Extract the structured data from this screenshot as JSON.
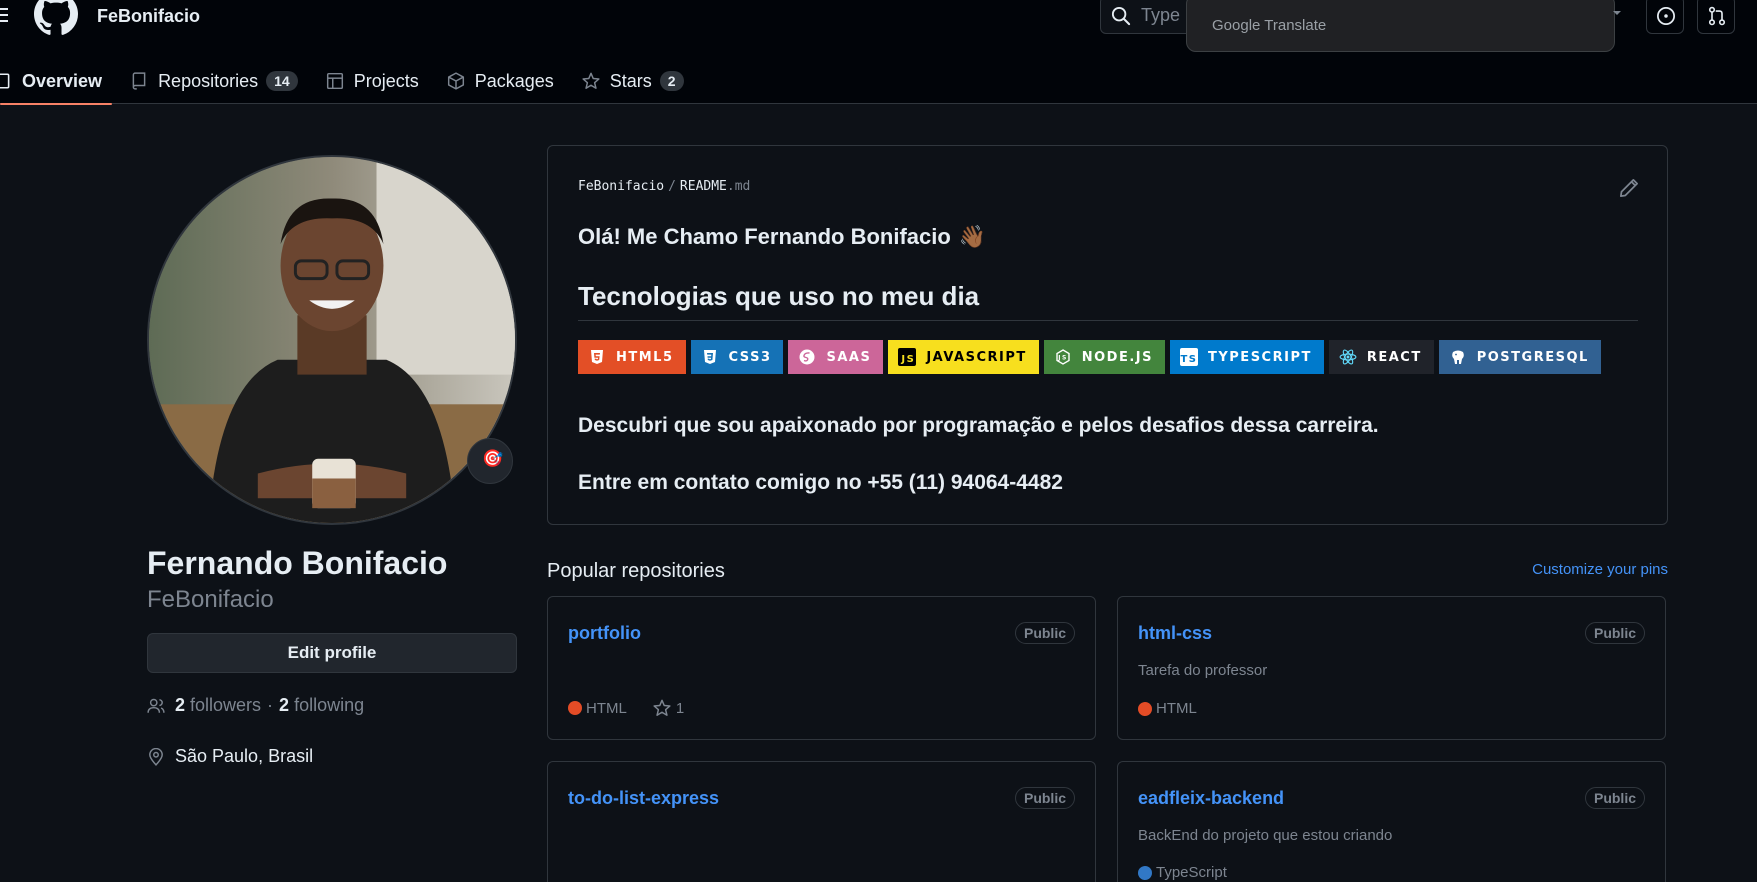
{
  "header": {
    "username": "FeBonifacio",
    "search_placeholder": "Type [",
    "translate_label": "Google Translate"
  },
  "tabs": [
    {
      "label": "Overview",
      "active": true
    },
    {
      "label": "Repositories",
      "count": "14"
    },
    {
      "label": "Projects"
    },
    {
      "label": "Packages"
    },
    {
      "label": "Stars",
      "count": "2"
    }
  ],
  "profile": {
    "full_name": "Fernando Bonifacio",
    "login": "FeBonifacio",
    "edit_label": "Edit profile",
    "followers_count": "2",
    "followers_label": "followers",
    "separator": "·",
    "following_count": "2",
    "following_label": "following",
    "location": "São Paulo, Brasil",
    "status_emoji": "🎯"
  },
  "readme": {
    "owner": "FeBonifacio",
    "file_base": "README",
    "file_ext": ".md",
    "heading": "Olá! Me Chamo Fernando Bonifacio",
    "heading_emoji": "👋🏾",
    "subheading": "Tecnologias que uso no meu dia",
    "badges": [
      {
        "label": "HTML5",
        "color": "#e34f26",
        "icon_color": "#ffffff"
      },
      {
        "label": "CSS3",
        "color": "#1572b6",
        "icon_color": "#ffffff"
      },
      {
        "label": "SAAS",
        "color": "#cc6699",
        "icon_color": "#ffffff"
      },
      {
        "label": "JAVASCRIPT",
        "color": "#f7df1e",
        "icon_color": "#000000"
      },
      {
        "label": "NODE.JS",
        "color": "#43853d",
        "icon_color": "#ffffff"
      },
      {
        "label": "TYPESCRIPT",
        "color": "#007acc",
        "icon_color": "#ffffff"
      },
      {
        "label": "REACT",
        "color": "#20232a",
        "icon_color": "#61dafb"
      },
      {
        "label": "POSTGRESQL",
        "color": "#316192",
        "icon_color": "#ffffff"
      }
    ],
    "paragraph_1": "Descubri que sou apaixonado por programação e pelos desafios dessa carreira.",
    "paragraph_2": "Entre em contato comigo no +55 (11) 94064-4482"
  },
  "popular": {
    "title": "Popular repositories",
    "customize_label": "Customize your pins",
    "repos": [
      {
        "name": "portfolio",
        "visibility": "Public",
        "description": "",
        "language": "HTML",
        "language_color": "#e34c26",
        "stars": "1"
      },
      {
        "name": "html-css",
        "visibility": "Public",
        "description": "Tarefa do professor",
        "language": "HTML",
        "language_color": "#e34c26"
      },
      {
        "name": "to-do-list-express",
        "visibility": "Public",
        "description": ""
      },
      {
        "name": "eadfleix-backend",
        "visibility": "Public",
        "description": "BackEnd do projeto que estou criando",
        "language": "TypeScript",
        "language_color": "#3178c6"
      }
    ]
  },
  "colors": {
    "background": "#0d1117",
    "header_bg": "#010409",
    "border": "#30363d",
    "link": "#4493f8",
    "muted": "#7d8590",
    "tab_underline": "#f78166"
  }
}
